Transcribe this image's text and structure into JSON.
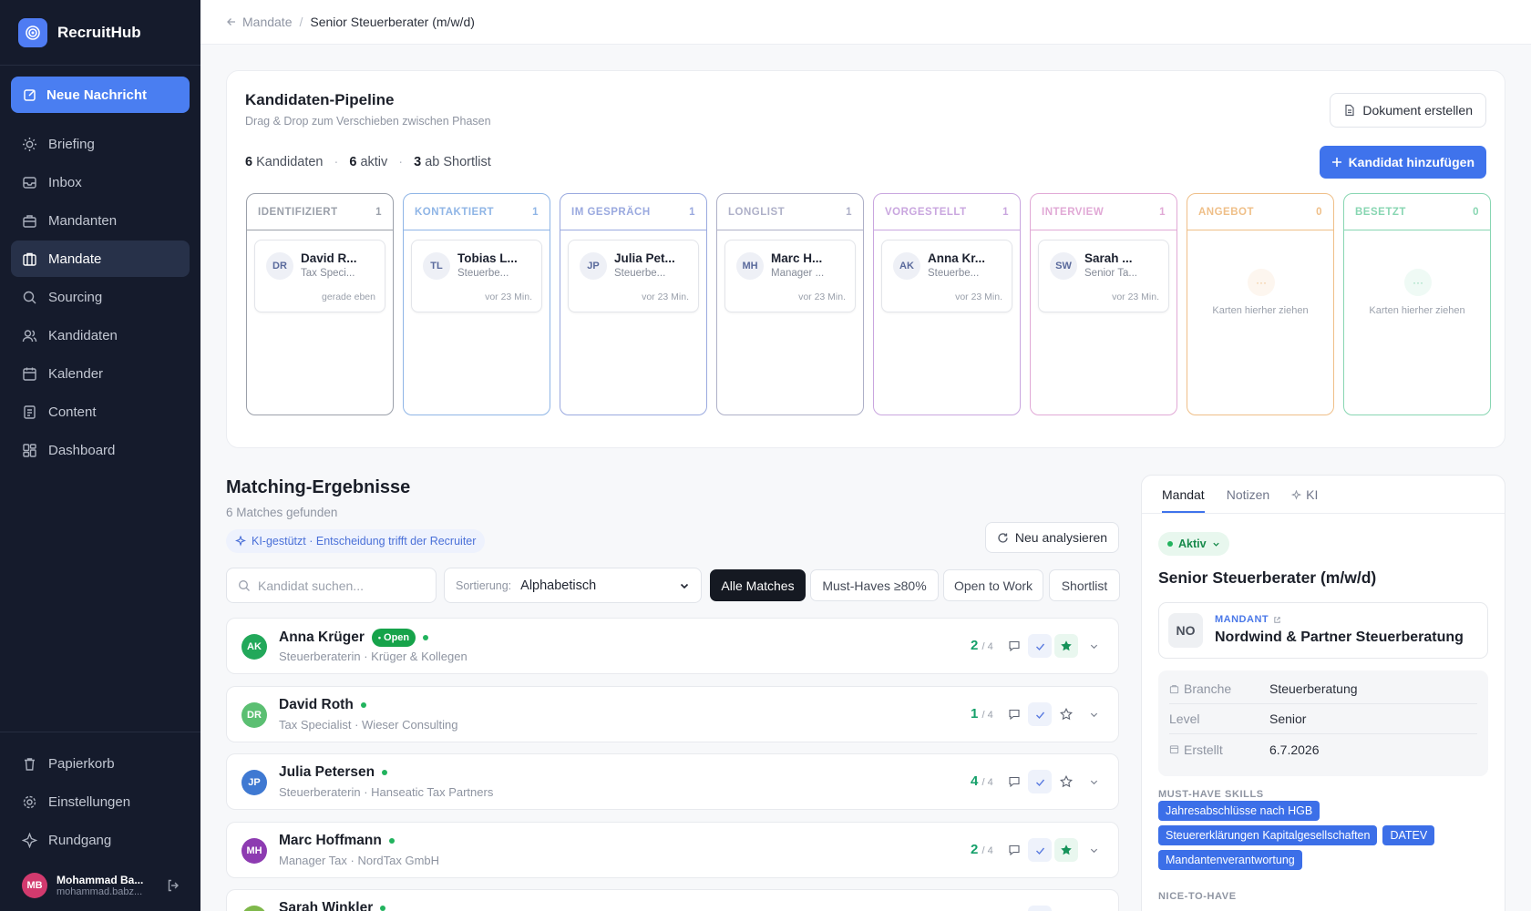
{
  "brand": {
    "name": "RecruitHub"
  },
  "sidebar": {
    "new_message": "Neue Nachricht",
    "items": [
      {
        "label": "Briefing",
        "icon": "sun-icon"
      },
      {
        "label": "Inbox",
        "icon": "inbox-icon"
      },
      {
        "label": "Mandanten",
        "icon": "building-icon"
      },
      {
        "label": "Mandate",
        "icon": "briefcase-icon",
        "active": true
      },
      {
        "label": "Sourcing",
        "icon": "search-icon"
      },
      {
        "label": "Kandidaten",
        "icon": "users-icon"
      },
      {
        "label": "Kalender",
        "icon": "calendar-icon"
      },
      {
        "label": "Content",
        "icon": "document-icon"
      },
      {
        "label": "Dashboard",
        "icon": "grid-icon"
      }
    ],
    "bottom_items": [
      {
        "label": "Papierkorb",
        "icon": "trash-icon"
      },
      {
        "label": "Einstellungen",
        "icon": "gear-icon"
      },
      {
        "label": "Rundgang",
        "icon": "compass-icon"
      }
    ],
    "user": {
      "initials": "MB",
      "name": "Mohammad Ba...",
      "email": "mohammad.babz..."
    }
  },
  "breadcrumb": {
    "parent": "Mandate",
    "separator": "/",
    "current": "Senior Steuerberater (m/w/d)"
  },
  "pipeline": {
    "title": "Kandidaten-Pipeline",
    "subtitle": "Drag & Drop zum Verschieben zwischen Phasen",
    "stats": [
      {
        "num": "6",
        "label": "Kandidaten"
      },
      {
        "num": "6",
        "label": "aktiv"
      },
      {
        "num": "3",
        "label": "ab Shortlist"
      }
    ],
    "stat_sep": "·",
    "doc_button": "Dokument erstellen",
    "add_button": "Kandidat hinzufügen",
    "columns": [
      {
        "name": "IDENTIFIZIERT",
        "count": "1",
        "color": "#9ba0aa",
        "card": {
          "initials": "DR",
          "name": "David R...",
          "role": "Tax Speci...",
          "time": "gerade eben"
        }
      },
      {
        "name": "KONTAKTIERT",
        "count": "1",
        "color": "#8fb5e6",
        "card": {
          "initials": "TL",
          "name": "Tobias L...",
          "role": "Steuerbe...",
          "time": "vor 23 Min."
        }
      },
      {
        "name": "IM GESPRÄCH",
        "count": "1",
        "color": "#9aa9df",
        "card": {
          "initials": "JP",
          "name": "Julia Pet...",
          "role": "Steuerbe...",
          "time": "vor 23 Min."
        }
      },
      {
        "name": "LONGLIST",
        "count": "1",
        "color": "#aeb0c8",
        "card": {
          "initials": "MH",
          "name": "Marc H...",
          "role": "Manager ...",
          "time": "vor 23 Min."
        }
      },
      {
        "name": "VORGESTELLT",
        "count": "1",
        "color": "#c9a6df",
        "card": {
          "initials": "AK",
          "name": "Anna Kr...",
          "role": "Steuerbe...",
          "time": "vor 23 Min."
        }
      },
      {
        "name": "INTERVIEW",
        "count": "1",
        "color": "#e1a9d6",
        "card": {
          "initials": "SW",
          "name": "Sarah ...",
          "role": "Senior Ta...",
          "time": "vor 23 Min."
        }
      },
      {
        "name": "ANGEBOT",
        "count": "0",
        "color": "#efbf88",
        "empty": "Karten hierher ziehen"
      },
      {
        "name": "BESETZT",
        "count": "0",
        "color": "#88d6b2",
        "empty": "Karten hierher ziehen"
      }
    ]
  },
  "matching": {
    "title": "Matching-Ergebnisse",
    "subtitle": "6 Matches gefunden",
    "ai_note": "KI-gestützt · Entscheidung trifft der Recruiter",
    "reanalyze": "Neu analysieren",
    "search_placeholder": "Kandidat suchen...",
    "sort_label": "Sortierung:",
    "sort_value": "Alphabetisch",
    "filters": [
      "Alle Matches",
      "Must-Haves ≥80%",
      "Open to Work",
      "Shortlist"
    ],
    "rows": [
      {
        "initials": "AK",
        "color": "#22a85a",
        "name": "Anna Krüger",
        "open_badge": "Open",
        "sub": "Steuerberaterin · Krüger & Kollegen",
        "score": "2",
        "total": "/ 4",
        "starred": true
      },
      {
        "initials": "DR",
        "color": "#5bbf72",
        "name": "David Roth",
        "sub": "Tax Specialist · Wieser Consulting",
        "score": "1",
        "total": "/ 4",
        "starred": false
      },
      {
        "initials": "JP",
        "color": "#3f79d2",
        "name": "Julia Petersen",
        "sub": "Steuerberaterin · Hanseatic Tax Partners",
        "score": "4",
        "total": "/ 4",
        "starred": false
      },
      {
        "initials": "MH",
        "color": "#8d3bb1",
        "name": "Marc Hoffmann",
        "sub": "Manager Tax · NordTax GmbH",
        "score": "2",
        "total": "/ 4",
        "starred": true
      },
      {
        "initials": "SW",
        "color": "#7fb84b",
        "name": "Sarah Winkler",
        "sub": "",
        "score": "",
        "total": "",
        "starred": false
      }
    ]
  },
  "panel": {
    "tabs": [
      "Mandat",
      "Notizen",
      "KI"
    ],
    "status": "Aktiv",
    "title": "Senior Steuerberater (m/w/d)",
    "client_label": "MANDANT",
    "client_initials": "NO",
    "client_name": "Nordwind & Partner Steuerberatung",
    "facts": [
      {
        "key": "Branche",
        "value": "Steuerberatung"
      },
      {
        "key": "Level",
        "value": "Senior"
      },
      {
        "key": "Erstellt",
        "value": "6.7.2026"
      }
    ],
    "must_have_label": "MUST-HAVE SKILLS",
    "must_have": [
      "Jahresabschlüsse nach HGB",
      "Steuererklärungen Kapitalgesellschaften",
      "DATEV",
      "Mandantenverantwortung"
    ],
    "nice_to_have_label": "NICE-TO-HAVE"
  }
}
